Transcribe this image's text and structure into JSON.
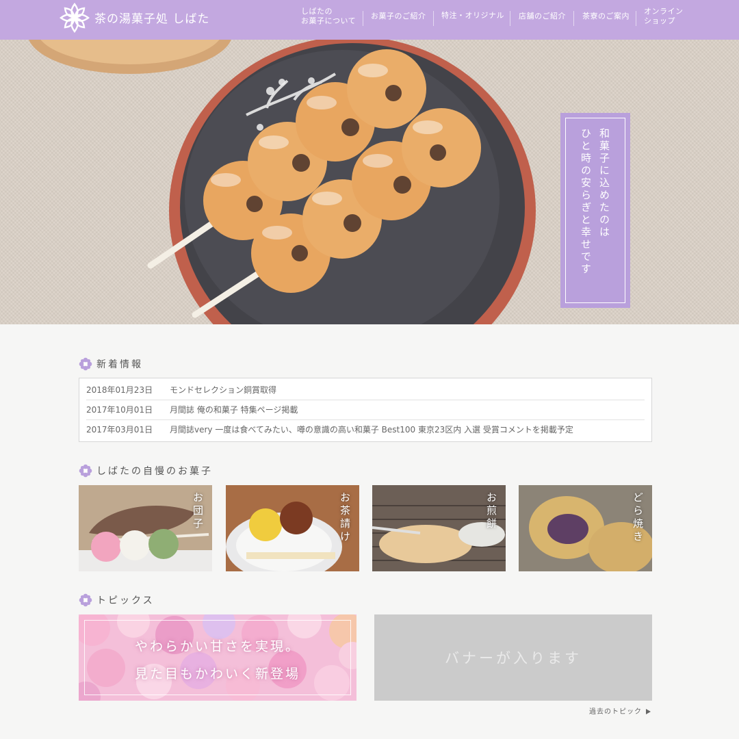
{
  "header": {
    "site_title": "茶の湯菓子処 しばた",
    "logo_icon": "flower-logo-icon",
    "nav": [
      {
        "label": "しばたの\nお菓子について"
      },
      {
        "label": "お菓子のご紹介"
      },
      {
        "label": "特注・オリジナル"
      },
      {
        "label": "店舗のご紹介"
      },
      {
        "label": "茶寮のご案内"
      },
      {
        "label": "オンライン\nショップ"
      }
    ]
  },
  "hero": {
    "tagline_lines": [
      "和菓子に込めたのは",
      "ひと時の安らぎと幸せです"
    ]
  },
  "news": {
    "heading": "新着情報",
    "items": [
      {
        "date": "2018年01月23日",
        "text": "モンドセレクション銅賞取得"
      },
      {
        "date": "2017年10月01日",
        "text": "月間誌 俺の和菓子 特集ページ掲載"
      },
      {
        "date": "2017年03月01日",
        "text": "月間誌very 一度は食べてみたい、噂の意識の高い和菓子 Best100 東京23区内 入選 受賞コメントを掲載予定"
      }
    ]
  },
  "sweets": {
    "heading": "しばたの自慢のお菓子",
    "items": [
      {
        "label": "お団子"
      },
      {
        "label": "お茶請け"
      },
      {
        "label": "お煎餅"
      },
      {
        "label": "どら焼き"
      }
    ]
  },
  "topics": {
    "heading": "トピックス",
    "candy_banner_lines": [
      "やわらかい甘さを実現。",
      "見た目もかわいく新登場"
    ],
    "placeholder_text": "バナーが入ります",
    "past_link": "過去のトピック"
  },
  "colors": {
    "header_bg": "#c3a8e0",
    "accent_purple": "#b9a0dc",
    "page_bg": "#f6f6f5"
  }
}
